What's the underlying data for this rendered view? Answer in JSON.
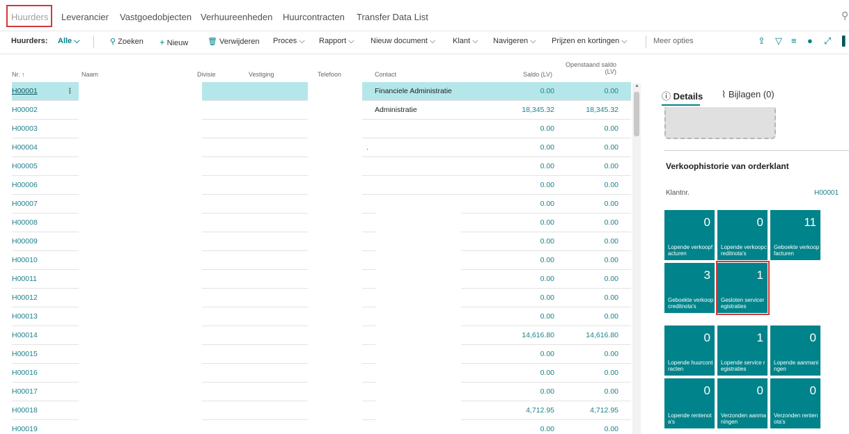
{
  "nav": {
    "tabs": [
      "Huurders",
      "Leverancier",
      "Vastgoedobjecten",
      "Verhuureenheden",
      "Huurcontracten",
      "Transfer Data List"
    ],
    "active": "Huurders"
  },
  "actions": {
    "page_label": "Huurders:",
    "filter": "Alle",
    "search": "Zoeken",
    "new": "Nieuw",
    "delete": "Verwijderen",
    "process": "Proces",
    "report": "Rapport",
    "new_doc": "Nieuw document",
    "customer": "Klant",
    "navigate": "Navigeren",
    "prices": "Prijzen en kortingen",
    "more": "Meer opties"
  },
  "columns": {
    "nr": "Nr. ↑",
    "naam": "Naam",
    "divisie": "Divisie",
    "vestiging": "Vestiging",
    "telefoon": "Telefoon",
    "contact": "Contact",
    "saldo": "Saldo (LV)",
    "open_l1": "Openstaand saldo",
    "open_l2": "(LV)"
  },
  "rows": [
    {
      "nr": "H00001",
      "contact": "Financiele Administratie",
      "saldo": "0.00",
      "open": "0.00"
    },
    {
      "nr": "H00002",
      "contact": "Administratie",
      "saldo": "18,345.32",
      "open": "18,345.32"
    },
    {
      "nr": "H00003",
      "contact": "",
      "saldo": "0.00",
      "open": "0.00"
    },
    {
      "nr": "H00004",
      "contact": "",
      "saldo": "0.00",
      "open": "0.00"
    },
    {
      "nr": "H00005",
      "contact": "",
      "saldo": "0.00",
      "open": "0.00"
    },
    {
      "nr": "H00006",
      "contact": "",
      "saldo": "0.00",
      "open": "0.00"
    },
    {
      "nr": "H00007",
      "contact": "",
      "saldo": "0.00",
      "open": "0.00"
    },
    {
      "nr": "H00008",
      "contact": "",
      "saldo": "0.00",
      "open": "0.00"
    },
    {
      "nr": "H00009",
      "contact": "",
      "saldo": "0.00",
      "open": "0.00"
    },
    {
      "nr": "H00010",
      "contact": "",
      "saldo": "0.00",
      "open": "0.00"
    },
    {
      "nr": "H00011",
      "contact": "",
      "saldo": "0.00",
      "open": "0.00"
    },
    {
      "nr": "H00012",
      "contact": "",
      "saldo": "0.00",
      "open": "0.00"
    },
    {
      "nr": "H00013",
      "contact": "",
      "saldo": "0.00",
      "open": "0.00"
    },
    {
      "nr": "H00014",
      "contact": "",
      "saldo": "14,616.80",
      "open": "14,616.80"
    },
    {
      "nr": "H00015",
      "contact": "",
      "saldo": "0.00",
      "open": "0.00"
    },
    {
      "nr": "H00016",
      "contact": "",
      "saldo": "0.00",
      "open": "0.00"
    },
    {
      "nr": "H00017",
      "contact": "",
      "saldo": "0.00",
      "open": "0.00"
    },
    {
      "nr": "H00018",
      "contact": "",
      "saldo": "4,712.95",
      "open": "4,712.95"
    },
    {
      "nr": "H00019",
      "contact": "",
      "saldo": "0.00",
      "open": "0.00"
    }
  ],
  "factbox": {
    "tab_details": "Details",
    "tab_attachments": "Bijlagen (0)",
    "section_title": "Verkoophistorie van orderklant",
    "klant_label": "Klantnr.",
    "klant_value": "H00001",
    "tiles_history": [
      {
        "num": "0",
        "label": "Lopende verkoopfacturen"
      },
      {
        "num": "0",
        "label": "Lopende verkoopcreditnota's"
      },
      {
        "num": "11",
        "label": "Geboekte verkoopfacturen"
      },
      {
        "num": "3",
        "label": "Geboekte verkoopcreditnota's"
      },
      {
        "num": "1",
        "label": "Gesloten serviceregistraties"
      }
    ],
    "tiles_status": [
      {
        "num": "0",
        "label": "Lopende huurcontracten"
      },
      {
        "num": "1",
        "label": "Lopende service registraties"
      },
      {
        "num": "0",
        "label": "Lopende aanmaningen"
      },
      {
        "num": "0",
        "label": "Lopende rentenota's"
      },
      {
        "num": "0",
        "label": "Verzonden aanmaningen"
      },
      {
        "num": "0",
        "label": "Verzonden rentenota's"
      }
    ]
  },
  "colors": {
    "accent": "#008489",
    "tile": "#00838a",
    "selected_row": "#b5e7ea",
    "highlight": "#d03a3a"
  }
}
